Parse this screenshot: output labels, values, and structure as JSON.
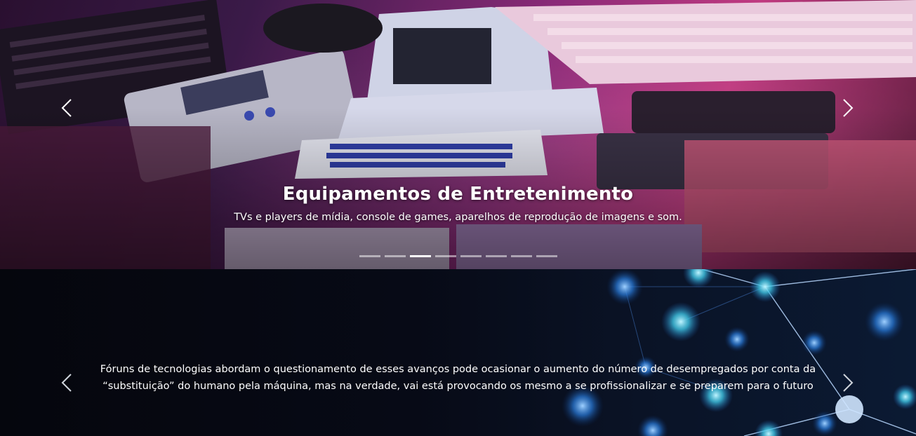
{
  "slides": [
    {
      "title": "Equipamentos de Entretenimento",
      "subtitle": "TVs e players de mídia, console de games, aparelhos de reprodução de imagens e som.",
      "indicators": {
        "count": 8,
        "active": 3
      }
    },
    {
      "text": "Fóruns de tecnologias abordam o questionamento de esses avanços pode ocasionar o aumento do número de desempregados por conta da “substituição” do humano pela máquina, mas na verdade, vai está provocando os mesmo a se profissionalizar e se preparem para o futuro"
    }
  ],
  "controls": {
    "prev_icon": "chevron-left-icon",
    "next_icon": "chevron-right-icon"
  },
  "colors": {
    "accent_magenta": "#c03a80",
    "network_blue": "#3fa8ff"
  }
}
